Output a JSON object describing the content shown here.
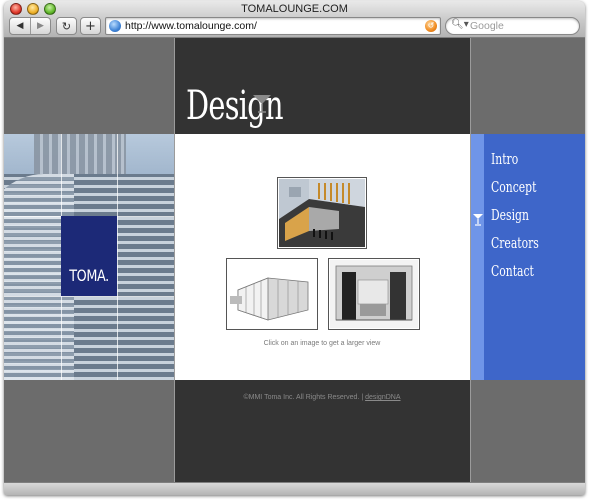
{
  "window": {
    "title": "TOMALOUNGE.COM"
  },
  "toolbar": {
    "back_icon": "back-arrow-icon",
    "forward_icon": "forward-arrow-icon",
    "reload_icon": "reload-icon",
    "add_label": "+",
    "url": "http://www.tomalounge.com/",
    "search_placeholder": "Google"
  },
  "page": {
    "heading": "Design",
    "logo_text": "TOMA.",
    "caption": "Click on an image to get a larger view",
    "footer_text": "©MMI Toma Inc. All Rights Reserved. | ",
    "footer_link": "designDNA",
    "nav": [
      {
        "label": "Intro"
      },
      {
        "label": "Concept"
      },
      {
        "label": "Design",
        "active": true
      },
      {
        "label": "Creators"
      },
      {
        "label": "Contact"
      }
    ]
  },
  "colors": {
    "nav_bg": "#3e66c9",
    "nav_strip": "#6f95e8",
    "dark_panel": "#333333",
    "gray_panel": "#6c6c6c",
    "logo_bg": "#1c2977"
  }
}
